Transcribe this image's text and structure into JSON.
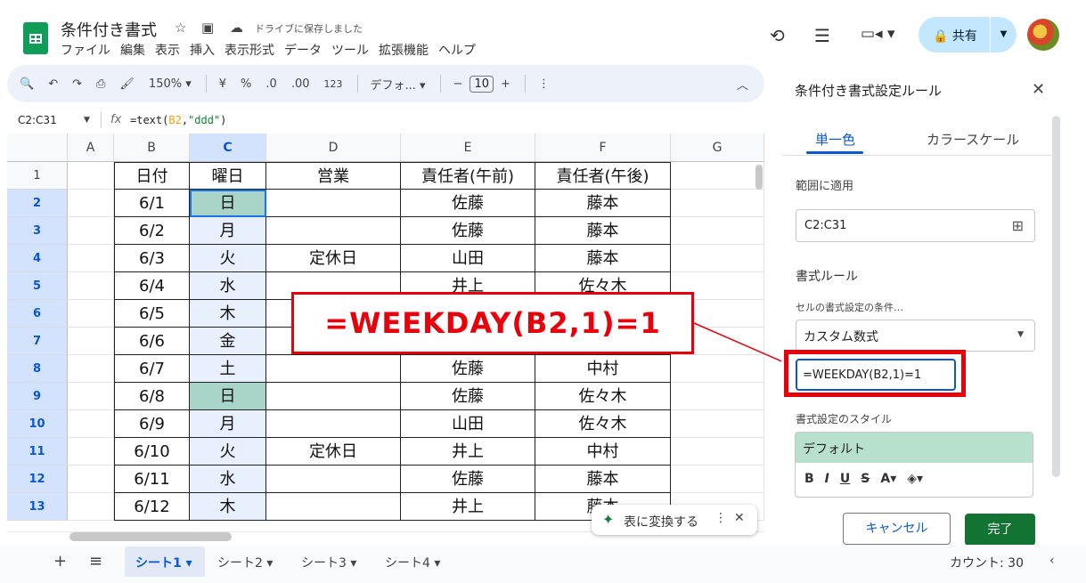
{
  "doc": {
    "title": "条件付き書式",
    "saved_status": "ドライブに保存しました",
    "menu": [
      "ファイル",
      "編集",
      "表示",
      "挿入",
      "表示形式",
      "データ",
      "ツール",
      "拡張機能",
      "ヘルプ"
    ],
    "share_label": "共有"
  },
  "toolbar": {
    "zoom": "150%",
    "currency": "¥",
    "percent": "%",
    "dec_decrease": ".0",
    "dec_increase": ".00",
    "number_format": "123",
    "font": "デフォ...",
    "font_size": "10",
    "minus": "−",
    "plus": "+"
  },
  "formula_bar": {
    "name_box": "C2:C31",
    "fx": "fx",
    "formula_prefix": "=text(",
    "formula_ref": "B2",
    "formula_comma": ",",
    "formula_str": "\"ddd\"",
    "formula_suffix": ")"
  },
  "columns": [
    "A",
    "B",
    "C",
    "D",
    "E",
    "F",
    "G"
  ],
  "rows": [
    {
      "n": "1",
      "b": "日付",
      "c": "曜日",
      "d": "営業",
      "e": "責任者(午前)",
      "f": "責任者(午後)"
    },
    {
      "n": "2",
      "b": "6/1",
      "c": "日",
      "d": "",
      "e": "佐藤",
      "f": "藤本",
      "hl": true
    },
    {
      "n": "3",
      "b": "6/2",
      "c": "月",
      "d": "",
      "e": "佐藤",
      "f": "藤本"
    },
    {
      "n": "4",
      "b": "6/3",
      "c": "火",
      "d": "定休日",
      "e": "山田",
      "f": "藤本"
    },
    {
      "n": "5",
      "b": "6/4",
      "c": "水",
      "d": "",
      "e": "井上",
      "f": "佐々木"
    },
    {
      "n": "6",
      "b": "6/5",
      "c": "木",
      "d": "",
      "e": "",
      "f": ""
    },
    {
      "n": "7",
      "b": "6/6",
      "c": "金",
      "d": "",
      "e": "",
      "f": ""
    },
    {
      "n": "8",
      "b": "6/7",
      "c": "土",
      "d": "",
      "e": "佐藤",
      "f": "中村"
    },
    {
      "n": "9",
      "b": "6/8",
      "c": "日",
      "d": "",
      "e": "佐藤",
      "f": "佐々木",
      "hl": true
    },
    {
      "n": "10",
      "b": "6/9",
      "c": "月",
      "d": "",
      "e": "山田",
      "f": "佐々木"
    },
    {
      "n": "11",
      "b": "6/10",
      "c": "火",
      "d": "定休日",
      "e": "井上",
      "f": "中村"
    },
    {
      "n": "12",
      "b": "6/11",
      "c": "水",
      "d": "",
      "e": "佐藤",
      "f": "藤本"
    },
    {
      "n": "13",
      "b": "6/12",
      "c": "木",
      "d": "",
      "e": "井上",
      "f": "藤本"
    }
  ],
  "callout": "=WEEKDAY(B2,1)=1",
  "convert_chip": {
    "label": "表に変換する"
  },
  "panel": {
    "title": "条件付き書式設定ルール",
    "tab_single": "単一色",
    "tab_scale": "カラースケール",
    "range_label": "範囲に適用",
    "range_value": "C2:C31",
    "rules_label": "書式ルール",
    "condition_label": "セルの書式設定の条件…",
    "condition_value": "カスタム数式",
    "formula_value": "=WEEKDAY(B2,1)=1",
    "style_label": "書式設定のスタイル",
    "style_preview": "デフォルト",
    "cancel": "キャンセル",
    "done": "完了"
  },
  "sheets": [
    "シート1",
    "シート2",
    "シート3",
    "シート4"
  ],
  "status": {
    "count": "カウント: 30"
  },
  "colors": {
    "accent": "#0b57d0",
    "highlight": "#a8d5c8",
    "callout": "#e8000b",
    "done": "#137333"
  }
}
